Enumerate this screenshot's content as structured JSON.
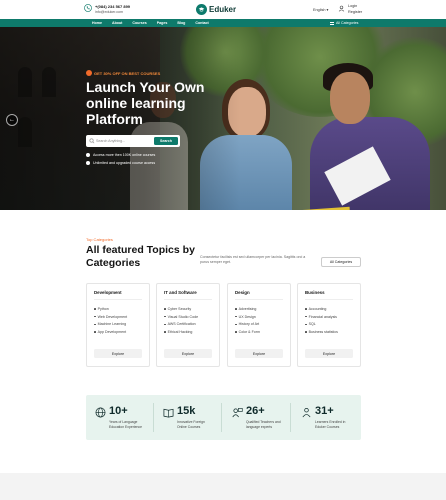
{
  "topbar": {
    "phone": "+(084) 234 567 899",
    "email": "info@eduker.com",
    "brand": "Eduker",
    "language": "English",
    "login": "Login",
    "register": "Register"
  },
  "nav": {
    "items": [
      "Home",
      "About",
      "Courses",
      "Pages",
      "Blog",
      "Contact"
    ],
    "categories": "All Categories"
  },
  "hero": {
    "badge": "GET 30% OFF ON BEST COURSES",
    "title": "Launch Your Own online learning Platform",
    "search_placeholder": "Search Anything...",
    "search_button": "Search",
    "features": [
      "Access more then 100K online courses",
      "Unlimited and upgraded course access"
    ]
  },
  "categories": {
    "kicker": "Top Categories",
    "title": "All featured Topics by Categories",
    "description": "Consectetur facilisis est sed ullamcorper per lacinia. Sagittis orci a purus semper eget.",
    "all_button": "All Categories",
    "cards": [
      {
        "title": "Development",
        "items": [
          "Python",
          "Web Development",
          "Machine Learning",
          "App Development"
        ],
        "button": "Explore"
      },
      {
        "title": "IT and Software",
        "items": [
          "Cyber Security",
          "Visual Studio Code",
          "AWS Certification",
          "Ethical Hacking"
        ],
        "button": "Explore"
      },
      {
        "title": "Design",
        "items": [
          "Advertising",
          "UX Design",
          "History of Art",
          "Color & Form"
        ],
        "button": "Explore"
      },
      {
        "title": "Business",
        "items": [
          "Accounting",
          "Financial analysis",
          "SQL",
          "Business statistics"
        ],
        "button": "Explore"
      }
    ]
  },
  "stats": [
    {
      "value": "10+",
      "label1": "Years of Language",
      "label2": "Education Experience",
      "icon": "globe-icon"
    },
    {
      "value": "15k",
      "label1": "Innovative Foreign",
      "label2": "Online Courses",
      "icon": "book-icon"
    },
    {
      "value": "26+",
      "label1": "Qualified Teachers and",
      "label2": "language experts",
      "icon": "teacher-icon"
    },
    {
      "value": "31+",
      "label1": "Learners Enrolled in",
      "label2": "Eduker Courses",
      "icon": "learners-icon"
    }
  ],
  "colors": {
    "primary": "#0e7a6b",
    "accent": "#f26b2a",
    "stats_bg": "#e7f3ee"
  }
}
